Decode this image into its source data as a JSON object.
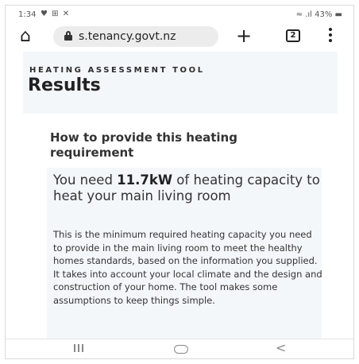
{
  "status_bar": {
    "time": "1:34",
    "left_icons": "♥ ⊞ ✕",
    "battery": "43%"
  },
  "browser": {
    "url": "s.tenancy.govt.nz",
    "tab_count": "2"
  },
  "page": {
    "eyebrow": "HEATING ASSESSMENT TOOL",
    "title": "Results",
    "section_heading": "How to provide this heating requirement",
    "need_prefix": "You need ",
    "need_value": "11.7kW",
    "need_suffix": " of heating capacity to heat your main living room",
    "description": "This is the minimum required heating capacity you need to provide in the main living room to meet the healthy homes standards, based on the information you supplied. It takes into account your local climate and the design and construction of your home. The tool makes some assumptions to keep things simple."
  },
  "nav": {
    "back_glyph": "<"
  }
}
